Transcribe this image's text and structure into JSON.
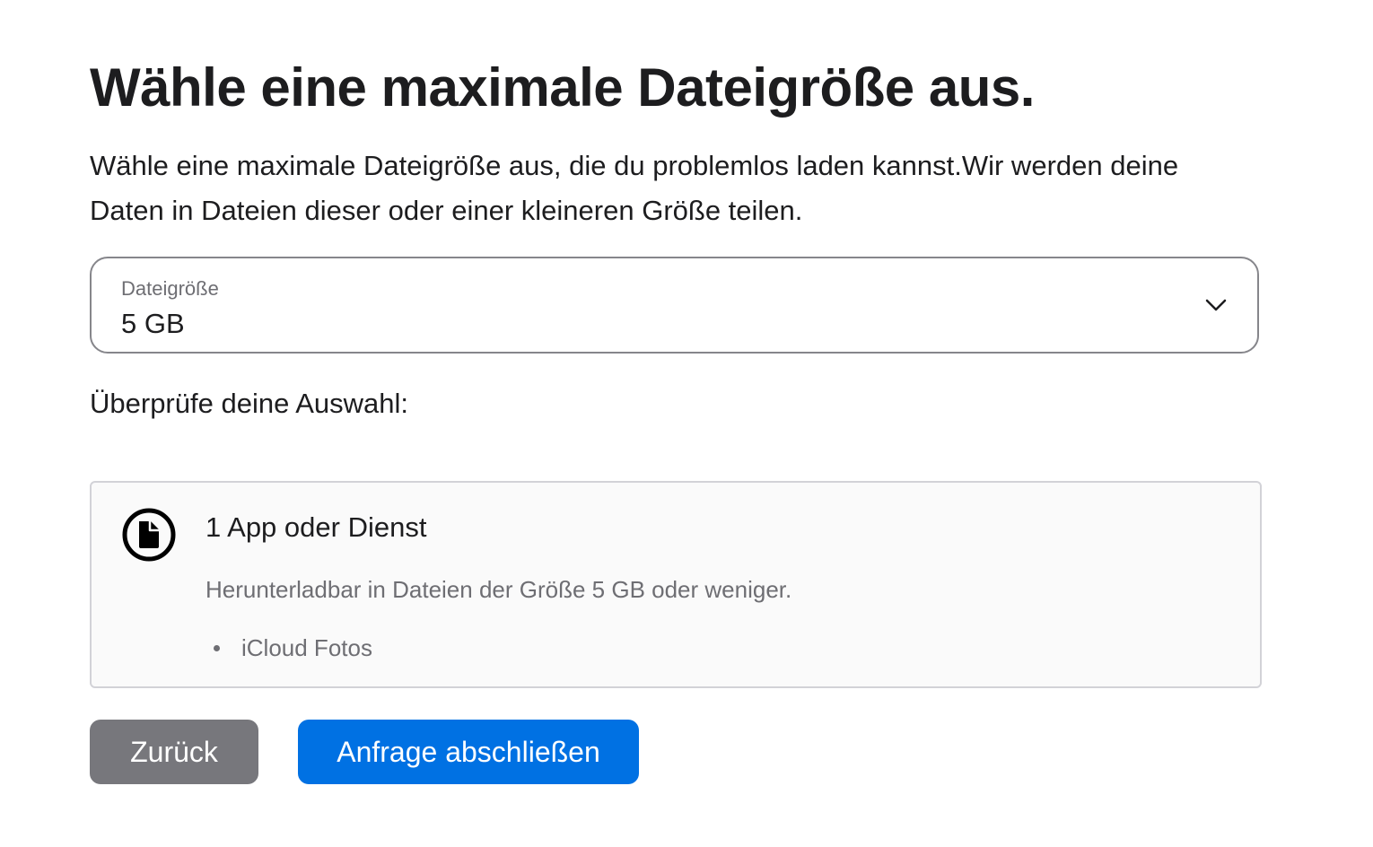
{
  "page": {
    "title": "Wähle eine maximale Dateigröße aus.",
    "intro": "Wähle eine maximale Dateigröße aus, die du problemlos laden kannst.Wir werden deine Daten in Dateien dieser oder einer kleineren Größe teilen."
  },
  "file_size_select": {
    "label": "Dateigröße",
    "selected_value": "5 GB",
    "icon": "chevron-down-icon"
  },
  "review": {
    "heading": "Überprüfe deine Auswahl:"
  },
  "summary_card": {
    "icon": "document-icon",
    "title": "1 App oder Dienst",
    "description": "Herunterladbar in Dateien der Größe 5 GB oder weniger.",
    "items": [
      "iCloud Fotos"
    ]
  },
  "buttons": {
    "back_label": "Zurück",
    "submit_label": "Anfrage abschließen"
  },
  "colors": {
    "primary_button": "#0071e3",
    "secondary_button": "#77777c",
    "text": "#1d1d1f",
    "secondary_text": "#6e6e73"
  }
}
